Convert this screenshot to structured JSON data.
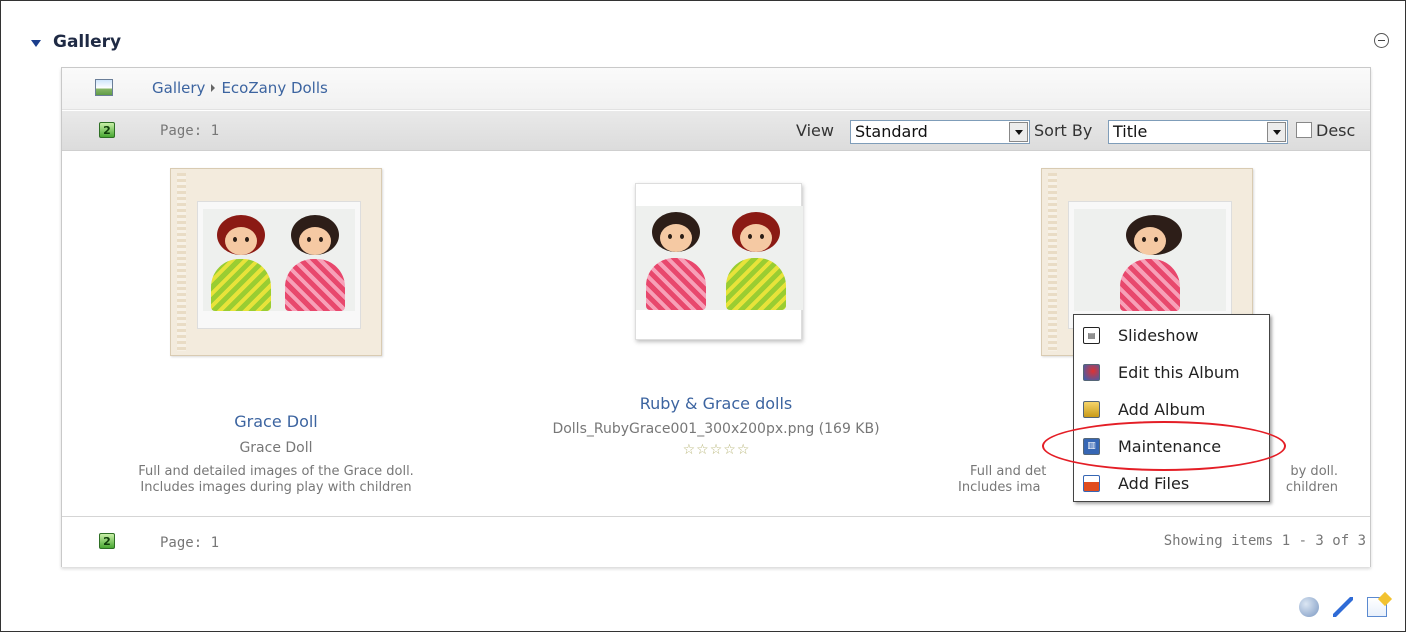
{
  "module": {
    "title": "Gallery",
    "collapse_label": "collapse"
  },
  "breadcrumb": {
    "root": "Gallery",
    "current": "EcoZany Dolls"
  },
  "toolbar": {
    "page_label": "Page: 1",
    "view_label": "View",
    "view_value": "Standard",
    "sort_label": "Sort By",
    "sort_value": "Title",
    "desc_label": "Desc",
    "desc_checked": false
  },
  "items": [
    {
      "type": "album",
      "title": "Grace Doll",
      "subtitle": "Grace Doll",
      "description_line1": "Full and detailed images of the Grace doll.",
      "description_line2": "Includes images during play with children"
    },
    {
      "type": "file",
      "title": "Ruby & Grace dolls",
      "subtitle": "Dolls_RubyGrace001_300x200px.png (169 KB)",
      "rating_stars": 0,
      "rating_max": 5
    },
    {
      "type": "album",
      "title": "",
      "subtitle": "",
      "description_line1_left": "Full and det",
      "description_line1_right": "by doll.",
      "description_line2_left": "Includes ima",
      "description_line2_right": "children"
    }
  ],
  "context_menu": {
    "items": [
      {
        "label": "Slideshow",
        "icon": "slideshow-icon"
      },
      {
        "label": "Edit this Album",
        "icon": "edit-album-icon"
      },
      {
        "label": "Add Album",
        "icon": "add-album-icon"
      },
      {
        "label": "Maintenance",
        "icon": "maintenance-icon"
      },
      {
        "label": "Add Files",
        "icon": "add-files-icon"
      }
    ],
    "highlighted": "Maintenance"
  },
  "footer": {
    "page_label": "Page: 1",
    "showing": "Showing items 1 - 3 of 3"
  },
  "bottom_icons": [
    "print-icon",
    "pencil-icon",
    "edit-content-icon"
  ],
  "colors": {
    "link": "#3c64a0",
    "highlight_ring": "#e41e26",
    "header_title": "#1f2a44"
  }
}
